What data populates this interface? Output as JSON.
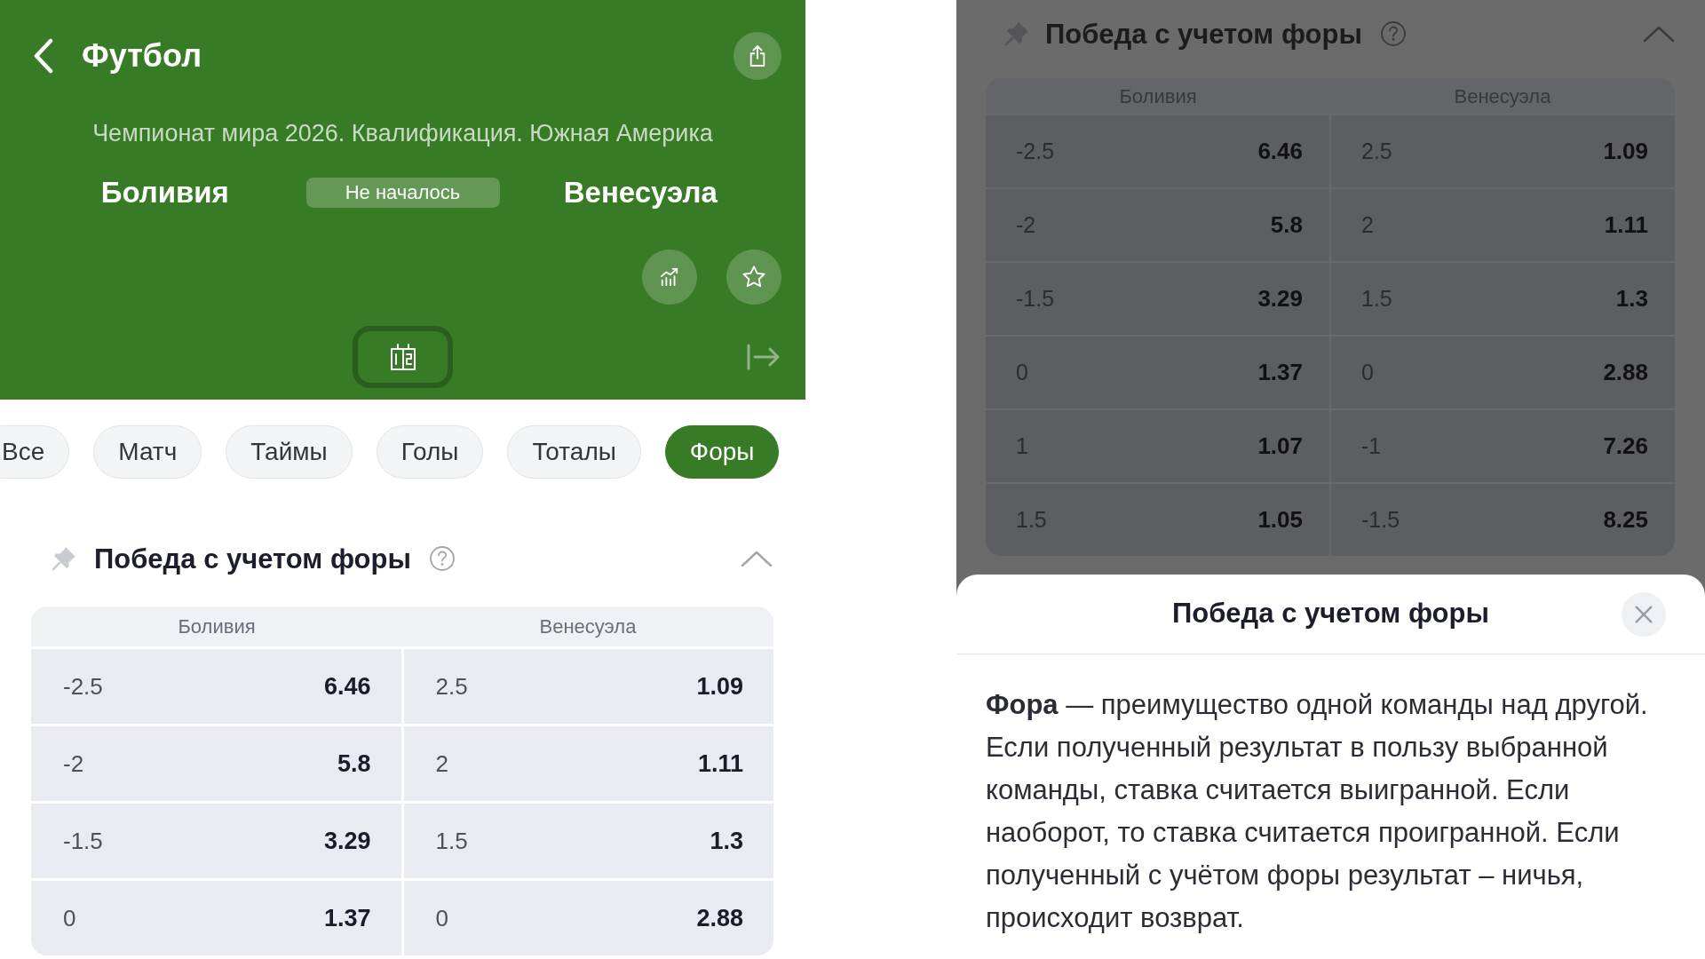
{
  "match_screen": {
    "header": {
      "title": "Футбол",
      "tournament": "Чемпионат мира 2026. Квалификация. Южная Америка",
      "home_team": "Боливия",
      "status": "Не началось",
      "away_team": "Венесуэла"
    },
    "market_tabs": [
      {
        "label": "Все",
        "selected": false
      },
      {
        "label": "Матч",
        "selected": false
      },
      {
        "label": "Таймы",
        "selected": false
      },
      {
        "label": "Голы",
        "selected": false
      },
      {
        "label": "Тоталы",
        "selected": false
      },
      {
        "label": "Форы",
        "selected": true
      }
    ],
    "market": {
      "title": "Победа с учетом форы",
      "expanded": true,
      "columns": [
        "Боливия",
        "Венесуэла"
      ],
      "rows": [
        {
          "home": {
            "handicap": "-2.5",
            "odds": "6.46"
          },
          "away": {
            "handicap": "2.5",
            "odds": "1.09"
          }
        },
        {
          "home": {
            "handicap": "-2",
            "odds": "5.8"
          },
          "away": {
            "handicap": "2",
            "odds": "1.11"
          }
        },
        {
          "home": {
            "handicap": "-1.5",
            "odds": "3.29"
          },
          "away": {
            "handicap": "1.5",
            "odds": "1.3"
          }
        },
        {
          "home": {
            "handicap": "0",
            "odds": "1.37"
          },
          "away": {
            "handicap": "0",
            "odds": "2.88"
          }
        }
      ]
    }
  },
  "info_screen": {
    "market": {
      "title": "Победа с учетом форы",
      "expanded": true,
      "columns": [
        "Боливия",
        "Венесуэла"
      ],
      "rows": [
        {
          "home": {
            "handicap": "-2.5",
            "odds": "6.46"
          },
          "away": {
            "handicap": "2.5",
            "odds": "1.09"
          }
        },
        {
          "home": {
            "handicap": "-2",
            "odds": "5.8"
          },
          "away": {
            "handicap": "2",
            "odds": "1.11"
          }
        },
        {
          "home": {
            "handicap": "-1.5",
            "odds": "3.29"
          },
          "away": {
            "handicap": "1.5",
            "odds": "1.3"
          }
        },
        {
          "home": {
            "handicap": "0",
            "odds": "1.37"
          },
          "away": {
            "handicap": "0",
            "odds": "2.88"
          }
        },
        {
          "home": {
            "handicap": "1",
            "odds": "1.07"
          },
          "away": {
            "handicap": "-1",
            "odds": "7.26"
          }
        },
        {
          "home": {
            "handicap": "1.5",
            "odds": "1.05"
          },
          "away": {
            "handicap": "-1.5",
            "odds": "8.25"
          }
        }
      ]
    },
    "sheet": {
      "title": "Победа с учетом форы",
      "text": "**Фора** — преимущество одной команды над другой. Если полученный результат в пользу выбранной команды, ставка считается выигранной. Если наоборот, то ставка считается проигранной. Если полученный с учётом форы результат – ничья, происходит возврат."
    }
  }
}
